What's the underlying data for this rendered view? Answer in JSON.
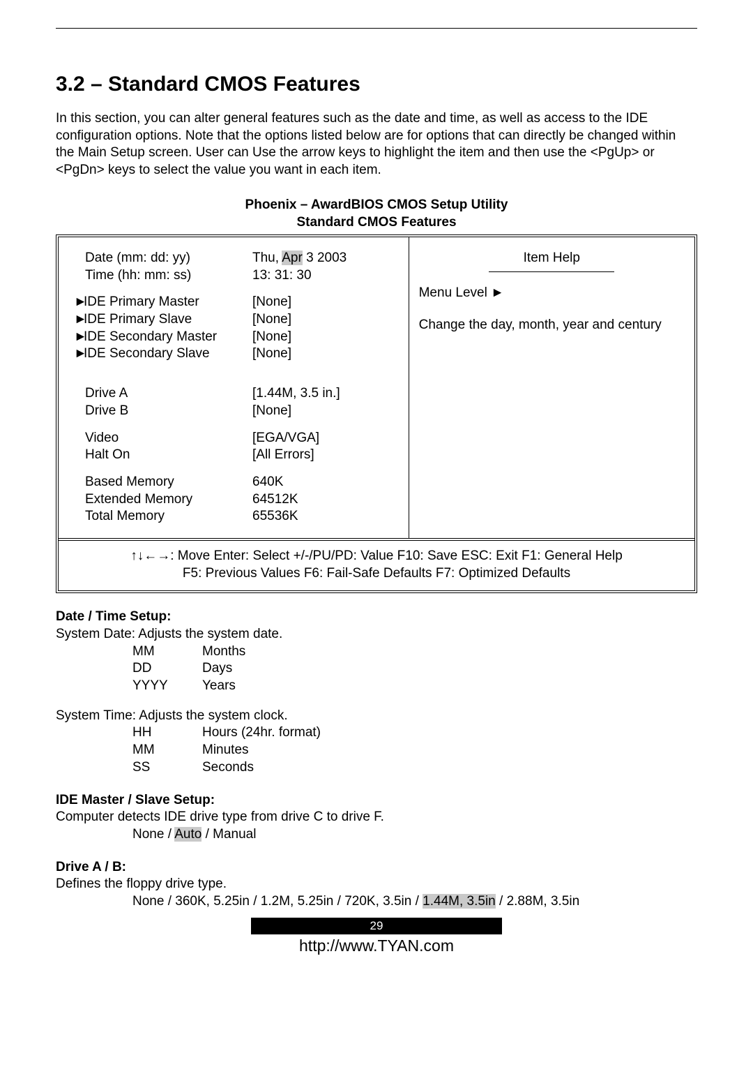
{
  "heading": "3.2 – Standard CMOS Features",
  "intro": "In this section, you can alter general features such as the date and time, as well as access to the IDE configuration options.  Note that the options listed below are for options that can directly be changed within the Main Setup screen.  User can Use the arrow keys to highlight the item and then use the <PgUp> or <PgDn> keys to select the value you want in each item.",
  "bios_title_1": "Phoenix – AwardBIOS CMOS Setup Utility",
  "bios_title_2": "Standard CMOS Features",
  "left": {
    "date_label": "Date (mm: dd: yy)",
    "date_value_pre": "Thu, ",
    "date_value_hl": "Apr",
    "date_value_post": "  3 2003",
    "time_label": "Time (hh: mm: ss)",
    "time_value": "13:  31:  30",
    "ide_pm": "IDE Primary Master",
    "ide_ps": "IDE Primary Slave",
    "ide_sm": "IDE Secondary Master",
    "ide_ss": "IDE Secondary Slave",
    "none": "[None]",
    "drive_a": "Drive A",
    "drive_a_v": "[1.44M, 3.5 in.]",
    "drive_b": "Drive B",
    "drive_b_v": "[None]",
    "video": "Video",
    "video_v": "[EGA/VGA]",
    "halt": "Halt On",
    "halt_v": "[All Errors]",
    "bmem": "Based Memory",
    "bmem_v": "640K",
    "emem": "Extended Memory",
    "emem_v": "64512K",
    "tmem": "Total Memory",
    "tmem_v": "65536K"
  },
  "right": {
    "item_help": "Item Help",
    "menu_level": "Menu Level  ►",
    "help_text": "Change the day, month, year and century"
  },
  "footer1": "↑↓←→: Move  Enter: Select  +/-/PU/PD: Value  F10: Save   ESC: Exit  F1: General Help",
  "footer2": "F5: Previous Values   F6: Fail-Safe Defaults   F7: Optimized Defaults",
  "s_date": {
    "h": "Date / Time Setup:",
    "l1": "System Date: Adjusts the system date.",
    "mm_k": "MM",
    "mm_v": "Months",
    "dd_k": "DD",
    "dd_v": "Days",
    "yy_k": "YYYY",
    "yy_v": "Years",
    "l2": "System Time: Adjusts the system clock.",
    "hh_k": "HH",
    "hh_v": "Hours (24hr. format)",
    "mn_k": "MM",
    "mn_v": "Minutes",
    "ss_k": "SS",
    "ss_v": "Seconds"
  },
  "s_ide": {
    "h": "IDE Master / Slave Setup:",
    "l1": "Computer detects IDE drive type from drive C to drive F.",
    "opt_pre": "None / ",
    "opt_hl": "Auto",
    "opt_post": " / Manual"
  },
  "s_drive": {
    "h": "Drive A / B:",
    "l1": "Defines the floppy drive type.",
    "opt_pre": "None / 360K, 5.25in / 1.2M, 5.25in / 720K, 3.5in / ",
    "opt_hl": "1.44M, 3.5in",
    "opt_post": " / 2.88M, 3.5in"
  },
  "page_number": "29",
  "footer_url": "http://www.TYAN.com"
}
